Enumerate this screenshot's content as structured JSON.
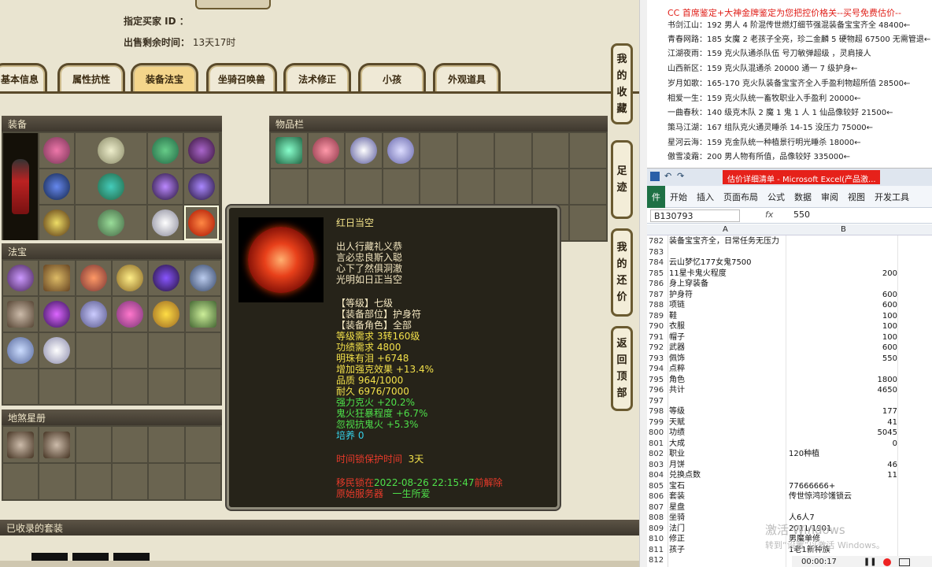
{
  "game": {
    "buyer_label": "指定买家 ID ：",
    "time_left_label": "出售剩余时间：",
    "time_left_value": "13天17时",
    "tabs": [
      "基本信息",
      "属性抗性",
      "装备法宝",
      "坐骑召唤兽",
      "法术修正",
      "小孩",
      "外观道具"
    ],
    "active_tab": "装备法宝",
    "equip_head": "装备",
    "items_head": "物品栏",
    "treasure_head": "法宝",
    "star_head": "地煞星册",
    "collected_head": "已收录的套装",
    "side_buttons": [
      {
        "label": [
          "我",
          "的",
          "收",
          "藏"
        ]
      },
      {
        "label": [
          "足",
          "迹"
        ]
      },
      {
        "label": [
          "我",
          "的",
          "还",
          "价"
        ]
      },
      {
        "label": [
          "返",
          "回",
          "顶",
          "部"
        ]
      }
    ]
  },
  "tooltip": {
    "name": "红日当空",
    "desc": [
      "出人行藏礼义恭",
      "言必忠良斯入聪",
      "心下了然俱洞澈",
      "光明如日正当空"
    ],
    "level": "【等级】七级",
    "slot": "【装备部位】护身符",
    "role": "【装备角色】全部",
    "stats_yellow": [
      "等级需求 3转160级",
      "功绩需求 4800",
      "明珠有泪 +6748",
      "增加强克效果 +13.4%",
      "品质 964/1000",
      "耐久 6976/7000"
    ],
    "stats_green": [
      "强力克火 +20.2%",
      "鬼火狂暴程度 +6.7%",
      "忽视抗鬼火 +5.3%"
    ],
    "cultivate": "培养 0",
    "protect_label": "时间锁保护时间",
    "protect_value": "3天",
    "transfer_prefix": "移民锁在",
    "transfer_time": "2022-08-26 22:15:47",
    "transfer_suffix": "前解除",
    "server_label": "原始服务器",
    "server_value": "一生所爱"
  },
  "right": {
    "headline": "CC 首席鉴定+大神金牌鉴定为您把控价格关--买号免费估价--",
    "trades": [
      "书剑江山：192 男人 4 阶混传世燃灯细节强混装备宝宝齐全 48400←",
      "青春网路：185 女魔 2 老孩子全亮，珍二金麟 5 硬物超 67500 无需管退←",
      "江湖夜雨：159 克火队通杀队伍 号刀敏弹超级 ，灵肩接人",
      "山西新区：159 克火队混通杀 20000 通一 7 级护身←",
      "岁月如歌：165-170 克火队装备宝宝齐全入手盈利物超所值 28500←",
      "相爱一生：159 克火队统一畜牧职业入手盈利 20000←",
      "一曲春秋：140 级克木队 2 魔 1 鬼 1 人 1 仙品像较好 21500←",
      "策马江湖：167 组队克火通灵睡杀 14-15 没压力 75000←",
      "星河云海：159 克金队统一种植景行明光睡杀 18000←",
      "傲雪凌霜：200 男人物有所值，品像较好 335000←"
    ],
    "excel": {
      "title": "估价详细清单 - Microsoft Excel(产品激...",
      "menu": [
        "件",
        "开始",
        "插入",
        "页面布局",
        "公式",
        "数据",
        "审阅",
        "视图",
        "开发工具"
      ],
      "cell_ref": "B130793",
      "formula_value": "550",
      "col_a": "A",
      "col_b": "B",
      "rows": [
        {
          "n": "782",
          "a": "装备宝宝齐全，日常任务无压力",
          "b": ""
        },
        {
          "n": "783",
          "a": "",
          "b": ""
        },
        {
          "n": "784",
          "a": "云山梦忆177女鬼7500",
          "b": ""
        },
        {
          "n": "785",
          "a": "11星卡鬼火程度",
          "b": "200"
        },
        {
          "n": "786",
          "a": "身上穿装备",
          "b": ""
        },
        {
          "n": "787",
          "a": "护身符",
          "b": "600"
        },
        {
          "n": "788",
          "a": "项链",
          "b": "600"
        },
        {
          "n": "789",
          "a": "鞋",
          "b": "100"
        },
        {
          "n": "790",
          "a": "衣服",
          "b": "100"
        },
        {
          "n": "791",
          "a": "帽子",
          "b": "100"
        },
        {
          "n": "792",
          "a": "武器",
          "b": "600"
        },
        {
          "n": "793",
          "a": "佩饰",
          "b": "550"
        },
        {
          "n": "794",
          "a": "点粹",
          "b": ""
        },
        {
          "n": "795",
          "a": "角色",
          "b": "1800"
        },
        {
          "n": "796",
          "a": "共计",
          "b": "4650"
        },
        {
          "n": "797",
          "a": "",
          "b": ""
        },
        {
          "n": "798",
          "a": "等级",
          "b": "177"
        },
        {
          "n": "799",
          "a": "天赋",
          "b": "41"
        },
        {
          "n": "800",
          "a": "功绩",
          "b": "5045"
        },
        {
          "n": "801",
          "a": "大成",
          "b": "0"
        },
        {
          "n": "802",
          "a": "职业",
          "b": "120种植",
          "bl": true
        },
        {
          "n": "803",
          "a": "月饼",
          "b": "46"
        },
        {
          "n": "804",
          "a": "兑换点数",
          "b": "11"
        },
        {
          "n": "805",
          "a": "宝石",
          "b": "77666666+",
          "bl": true
        },
        {
          "n": "806",
          "a": "套装",
          "b": "传世惊鸿珍馐锁云",
          "bl": true
        },
        {
          "n": "807",
          "a": "星盘",
          "b": "",
          "bl": true
        },
        {
          "n": "808",
          "a": "坐骑",
          "b": "人6人7",
          "bl": true
        },
        {
          "n": "809",
          "a": "法门",
          "b": "2011/1901",
          "bl": true
        },
        {
          "n": "810",
          "a": "修正",
          "b": "男魔单修",
          "bl": true
        },
        {
          "n": "811",
          "a": "孩子",
          "b": "1老1新种族",
          "bl": true
        },
        {
          "n": "812",
          "a": "",
          "b": ""
        }
      ],
      "watermark": "激活 Windows",
      "watermark_sub": "转到“设置”以激活 Windows。",
      "timer": "00:00:17"
    }
  }
}
